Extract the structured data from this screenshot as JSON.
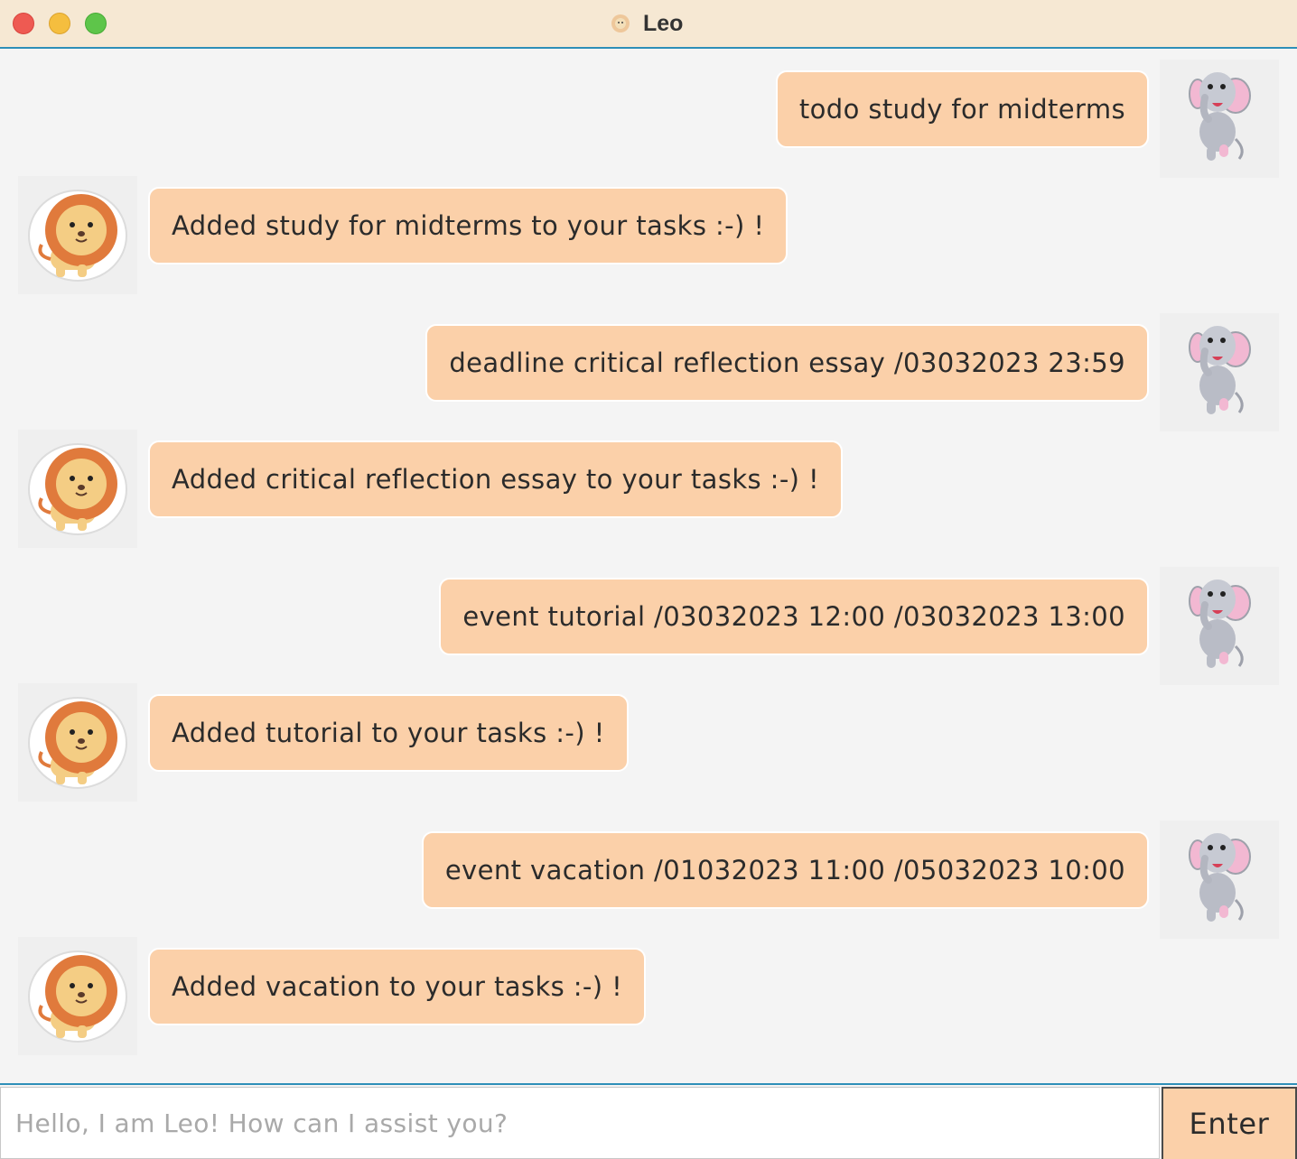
{
  "window": {
    "title": "Leo"
  },
  "messages": [
    {
      "sender": "user",
      "avatar": "elephant-avatar",
      "text": "todo study for midterms"
    },
    {
      "sender": "bot",
      "avatar": "lion-avatar",
      "text": "Added study for midterms to your tasks :-) !"
    },
    {
      "sender": "user",
      "avatar": "elephant-avatar",
      "text": "deadline critical reflection essay /03032023 23:59"
    },
    {
      "sender": "bot",
      "avatar": "lion-avatar",
      "text": "Added critical reflection essay to your tasks :-) !"
    },
    {
      "sender": "user",
      "avatar": "elephant-avatar",
      "text": "event tutorial /03032023 12:00 /03032023 13:00"
    },
    {
      "sender": "bot",
      "avatar": "lion-avatar",
      "text": "Added tutorial to your tasks :-) !"
    },
    {
      "sender": "user",
      "avatar": "elephant-avatar",
      "text": "event vacation /01032023 11:00 /05032023 10:00"
    },
    {
      "sender": "bot",
      "avatar": "lion-avatar",
      "text": "Added vacation to your tasks :-) !"
    }
  ],
  "input": {
    "placeholder": "Hello, I am Leo! How can I assist you?",
    "value": ""
  },
  "enter_button": {
    "label": "Enter"
  },
  "colors": {
    "titlebar": "#f6e8d3",
    "accent_border": "#2e8fb8",
    "bubble": "#fbd0a9",
    "background": "#f4f4f4"
  }
}
